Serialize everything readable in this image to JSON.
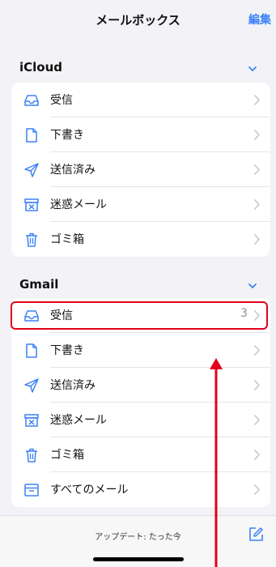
{
  "navbar": {
    "title": "メールボックス",
    "edit_label": "編集"
  },
  "sections": [
    {
      "title": "iCloud",
      "items": [
        {
          "label": "受信",
          "icon": "inbox-icon"
        },
        {
          "label": "下書き",
          "icon": "draft-icon"
        },
        {
          "label": "送信済み",
          "icon": "sent-icon"
        },
        {
          "label": "迷惑メール",
          "icon": "junk-icon"
        },
        {
          "label": "ゴミ箱",
          "icon": "trash-icon"
        }
      ]
    },
    {
      "title": "Gmail",
      "items": [
        {
          "label": "受信",
          "icon": "inbox-icon",
          "count": "3"
        },
        {
          "label": "下書き",
          "icon": "draft-icon"
        },
        {
          "label": "送信済み",
          "icon": "sent-icon"
        },
        {
          "label": "迷惑メール",
          "icon": "junk-icon"
        },
        {
          "label": "ゴミ箱",
          "icon": "trash-icon"
        },
        {
          "label": "すべてのメール",
          "icon": "archive-icon"
        }
      ]
    }
  ],
  "toolbar": {
    "status": "アップデート: たった今",
    "compose_icon": "compose-icon"
  },
  "colors": {
    "accent": "#3b82f6",
    "highlight": "#e3001b",
    "background": "#f2f2f7"
  }
}
